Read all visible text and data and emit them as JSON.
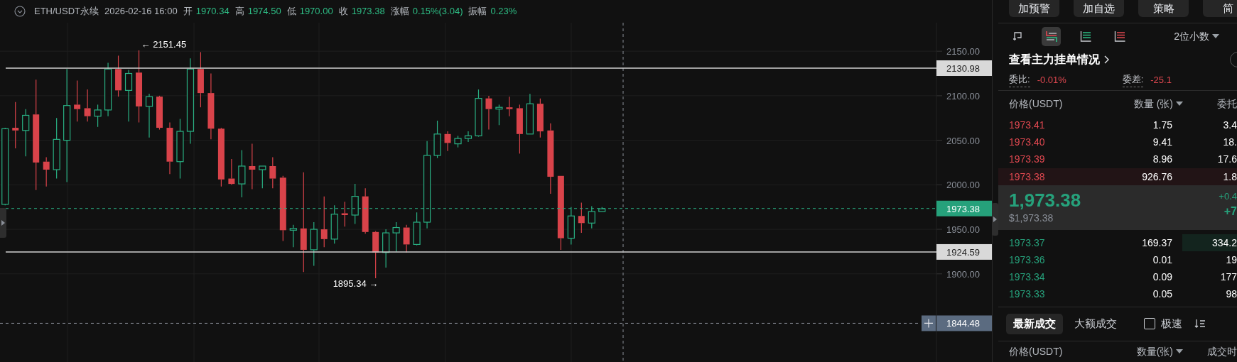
{
  "header": {
    "symbol": "ETH/USDT永续",
    "time": "2026-02-16 16:00",
    "fields": [
      {
        "label": "开",
        "value": "1970.34"
      },
      {
        "label": "高",
        "value": "1974.50"
      },
      {
        "label": "低",
        "value": "1970.00"
      },
      {
        "label": "收",
        "value": "1973.38"
      },
      {
        "label": "涨幅",
        "value": "0.15%(3.04)"
      },
      {
        "label": "振幅",
        "value": "0.23%"
      }
    ]
  },
  "chart": {
    "chart_data": {
      "type": "candlestick",
      "ylim": [
        1801,
        2182
      ],
      "grid": true,
      "yticks": [
        {
          "value": 2150,
          "label": "2150.00"
        },
        {
          "value": 2100,
          "label": "2100.00"
        },
        {
          "value": 2050,
          "label": "2050.00"
        },
        {
          "value": 2000,
          "label": "2000.00"
        },
        {
          "value": 1950,
          "label": "1950.00"
        },
        {
          "value": 1900,
          "label": "1900.00"
        }
      ],
      "categories": [
        null,
        null,
        null,
        null,
        null,
        null,
        null,
        null,
        null,
        null,
        null,
        null,
        null,
        null,
        null,
        null,
        null,
        null,
        null,
        null,
        null,
        null,
        null,
        null,
        null,
        null,
        null,
        null,
        null,
        null,
        null,
        null,
        null,
        null,
        null,
        null,
        null,
        null,
        null,
        null,
        null,
        null,
        null,
        null,
        null,
        null,
        null,
        null,
        null,
        null,
        null,
        null,
        null,
        null,
        null,
        null,
        null,
        null,
        null,
        null,
        null,
        null,
        null,
        null,
        null,
        null,
        null,
        null,
        null,
        null,
        null,
        null,
        null,
        null,
        null,
        null,
        null,
        null,
        null,
        null,
        null,
        null,
        null,
        null,
        null,
        null,
        null,
        null,
        null,
        null,
        null
      ],
      "ohlc": [
        [
          1978,
          2064,
          1977,
          2063
        ],
        [
          2064,
          2093,
          2041,
          2061
        ],
        [
          2061,
          2085,
          2032,
          2078
        ],
        [
          2079,
          2118,
          1994,
          2025
        ],
        [
          2026,
          2031,
          1998,
          2017
        ],
        [
          2017,
          2075,
          2007,
          2051
        ],
        [
          2050,
          2130,
          2003,
          2089
        ],
        [
          2090,
          2117,
          2071,
          2085
        ],
        [
          2086,
          2107,
          2071,
          2077
        ],
        [
          2077,
          2090,
          2065,
          2084
        ],
        [
          2084,
          2137,
          2077,
          2130
        ],
        [
          2130,
          2145,
          2099,
          2106
        ],
        [
          2106,
          2129,
          2071,
          2125
        ],
        [
          2126,
          2151,
          2070,
          2088
        ],
        [
          2088,
          2102,
          2053,
          2099
        ],
        [
          2099,
          2100,
          2062,
          2064
        ],
        [
          2064,
          2070,
          2012,
          2026
        ],
        [
          2026,
          2074,
          2007,
          2060
        ],
        [
          2060,
          2142,
          2046,
          2130
        ],
        [
          2130,
          2149,
          2087,
          2103
        ],
        [
          2103,
          2125,
          2051,
          2063
        ],
        [
          2063,
          2064,
          1998,
          2006
        ],
        [
          2007,
          2029,
          2000,
          2001
        ],
        [
          2001,
          2039,
          1986,
          2021
        ],
        [
          2021,
          2046,
          1995,
          2017
        ],
        [
          2017,
          2021,
          1996,
          2021
        ],
        [
          2021,
          2031,
          1996,
          2007
        ],
        [
          2008,
          2010,
          1937,
          1949
        ],
        [
          1949,
          1955,
          1930,
          1951
        ],
        [
          1951,
          2014,
          1902,
          1927
        ],
        [
          1927,
          1958,
          1909,
          1950
        ],
        [
          1950,
          1987,
          1930,
          1939
        ],
        [
          1939,
          1977,
          1934,
          1967
        ],
        [
          1968,
          1981,
          1953,
          1966
        ],
        [
          1966,
          2001,
          1956,
          1987
        ],
        [
          1987,
          1996,
          1945,
          1947
        ],
        [
          1947,
          1948,
          1895,
          1924
        ],
        [
          1924,
          1950,
          1907,
          1946
        ],
        [
          1946,
          1958,
          1925,
          1952
        ],
        [
          1952,
          1955,
          1924,
          1933
        ],
        [
          1933,
          1969,
          1932,
          1958
        ],
        [
          1958,
          2049,
          1951,
          2033
        ],
        [
          2033,
          2072,
          2030,
          2057
        ],
        [
          2057,
          2060,
          2038,
          2047
        ],
        [
          2046,
          2055,
          2042,
          2052
        ],
        [
          2052,
          2060,
          2048,
          2055
        ],
        [
          2055,
          2107,
          2054,
          2097
        ],
        [
          2097,
          2100,
          2062,
          2085
        ],
        [
          2085,
          2090,
          2067,
          2087
        ],
        [
          2087,
          2099,
          2077,
          2085
        ],
        [
          2086,
          2090,
          2035,
          2057
        ],
        [
          2057,
          2102,
          2057,
          2091
        ],
        [
          2091,
          2097,
          2053,
          2060
        ],
        [
          2061,
          2069,
          1990,
          2009
        ],
        [
          2010,
          2010,
          1927,
          1940
        ],
        [
          1940,
          1975,
          1933,
          1965
        ],
        [
          1965,
          1980,
          1946,
          1957
        ],
        [
          1957,
          1976,
          1951,
          1970
        ],
        [
          1970,
          1975,
          1970,
          1973
        ],
        null,
        null,
        null,
        null,
        null,
        null,
        null,
        null,
        null,
        null,
        null,
        null,
        null,
        null,
        null,
        null,
        null,
        null,
        null,
        null,
        null,
        null,
        null,
        null,
        null,
        null,
        null,
        null,
        null,
        null,
        null,
        null
      ],
      "ref_lines": [
        {
          "axis": "y",
          "value": 2130.98,
          "label": "2130.98",
          "color": "#d0d0d0"
        },
        {
          "axis": "y",
          "value": 1924.59,
          "label": "1924.59",
          "color": "#d0d0d0"
        },
        {
          "axis": "y",
          "value": 1973.38,
          "label": "1973.38",
          "color": "#29b083"
        },
        {
          "axis": "y",
          "value": 1844.48,
          "label": "1844.48",
          "color": "#8a8f98"
        }
      ],
      "annotations": [
        "← 2151.45",
        "1895.34 →"
      ]
    }
  },
  "actions": [
    {
      "label": "加预警"
    },
    {
      "label": "加自选"
    },
    {
      "label": "策略"
    },
    {
      "label": "简"
    }
  ],
  "book_views": [
    {
      "kind": "popout",
      "selected": false
    },
    {
      "kind": "both",
      "selected": true
    },
    {
      "kind": "bids",
      "selected": false
    },
    {
      "kind": "asks",
      "selected": false
    }
  ],
  "decimals": "2位小数",
  "depth_link": "查看主力挂单情况",
  "depth_toggle": {
    "on": false
  },
  "ratio": {
    "label": "委比:",
    "value": "-0.01%"
  },
  "diff": {
    "label": "委差:",
    "value": "-25.1"
  },
  "book_columns": [
    "价格(USDT)",
    "数量 (张)",
    "委托"
  ],
  "asks": [
    {
      "price": "1973.41",
      "amount": "1.75",
      "total": "3.4",
      "highlighted": false
    },
    {
      "price": "1973.40",
      "amount": "9.41",
      "total": "18.",
      "highlighted": false
    },
    {
      "price": "1973.39",
      "amount": "8.96",
      "total": "17.6",
      "highlighted": false
    },
    {
      "price": "1973.38",
      "amount": "926.76",
      "total": "1.8",
      "highlighted": true
    }
  ],
  "last": {
    "price": "1,973.38",
    "usd": "$1,973.38",
    "change_pct": "+0.4",
    "change": "+7"
  },
  "bids": [
    {
      "price": "1973.37",
      "amount": "169.37",
      "total": "334.2",
      "level": 0.23
    },
    {
      "price": "1973.36",
      "amount": "0.01",
      "total": "19"
    },
    {
      "price": "1973.34",
      "amount": "0.09",
      "total": "177"
    },
    {
      "price": "1973.33",
      "amount": "0.05",
      "total": "98"
    }
  ],
  "trade_tabs": [
    {
      "label": "最新成交",
      "selected": true
    },
    {
      "label": "大额成交",
      "selected": false
    }
  ],
  "fast": {
    "label": "极速",
    "checked": false
  },
  "trade_columns": [
    "价格(USDT)",
    "数量(张)",
    "成交时"
  ]
}
